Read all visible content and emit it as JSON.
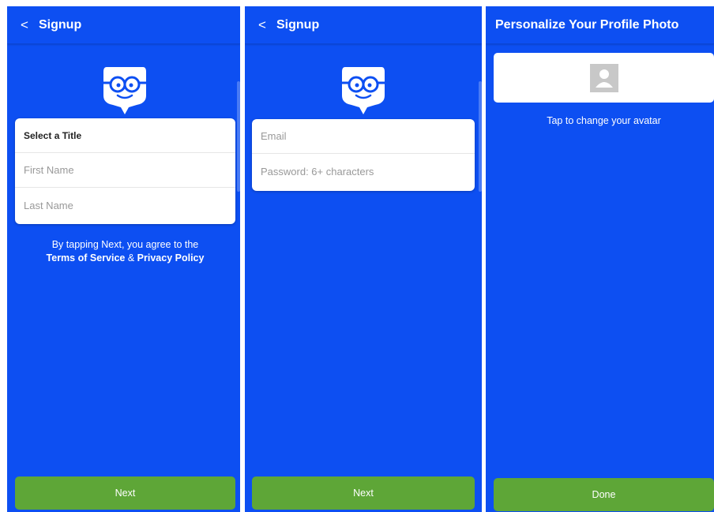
{
  "screens": [
    {
      "header": {
        "back_glyph": "<",
        "title": "Signup"
      },
      "fields": [
        {
          "label": "Select a Title",
          "kind": "select"
        },
        {
          "placeholder": "First Name"
        },
        {
          "placeholder": "Last Name"
        }
      ],
      "agreement": {
        "prefix": "By tapping Next, you agree to the",
        "terms_link": "Terms of Service",
        "amp": "&",
        "privacy_link": "Privacy Policy"
      },
      "button_label": "Next"
    },
    {
      "header": {
        "back_glyph": "<",
        "title": "Signup"
      },
      "fields": [
        {
          "placeholder": "Email"
        },
        {
          "placeholder": "Password: 6+ characters"
        }
      ],
      "button_label": "Next"
    },
    {
      "header": {
        "title": "Personalize Your Profile Photo"
      },
      "avatar_hint": "Tap to change your avatar",
      "button_label": "Done"
    }
  ],
  "colors": {
    "background": "#0d4ff2",
    "button": "#5ea637",
    "card": "#ffffff",
    "placeholder_text": "#999999"
  },
  "icons": [
    "back-chevron-icon",
    "mascot-logo-icon",
    "default-avatar-icon"
  ]
}
